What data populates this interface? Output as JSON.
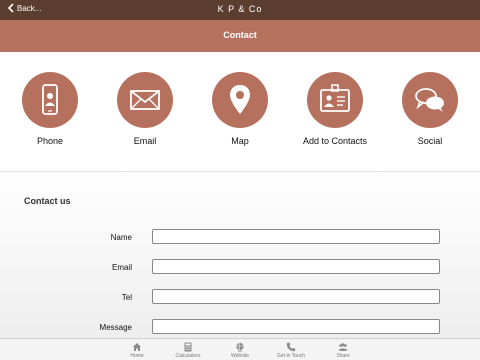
{
  "topbar": {
    "back_label": "Back...",
    "title": "K P & Co"
  },
  "header": {
    "title": "Contact"
  },
  "actions": [
    {
      "label": "Phone",
      "icon": "phone-icon"
    },
    {
      "label": "Email",
      "icon": "envelope-icon"
    },
    {
      "label": "Map",
      "icon": "map-pin-icon"
    },
    {
      "label": "Add to Contacts",
      "icon": "contact-card-icon"
    },
    {
      "label": "Social",
      "icon": "speech-bubbles-icon"
    }
  ],
  "form": {
    "title": "Contact us",
    "fields": [
      {
        "label": "Name",
        "value": ""
      },
      {
        "label": "Email",
        "value": ""
      },
      {
        "label": "Tel",
        "value": ""
      },
      {
        "label": "Message",
        "value": ""
      }
    ]
  },
  "tabbar": {
    "items": [
      {
        "label": "Home",
        "icon": "home-icon"
      },
      {
        "label": "Calculators",
        "icon": "calculator-icon"
      },
      {
        "label": "Website",
        "icon": "globe-icon"
      },
      {
        "label": "Get in Touch",
        "icon": "phone-handset-icon"
      },
      {
        "label": "Share",
        "icon": "people-icon"
      }
    ]
  },
  "colors": {
    "topbar": "#5b3e30",
    "accent": "#b5705e",
    "background": "#ffffff"
  }
}
